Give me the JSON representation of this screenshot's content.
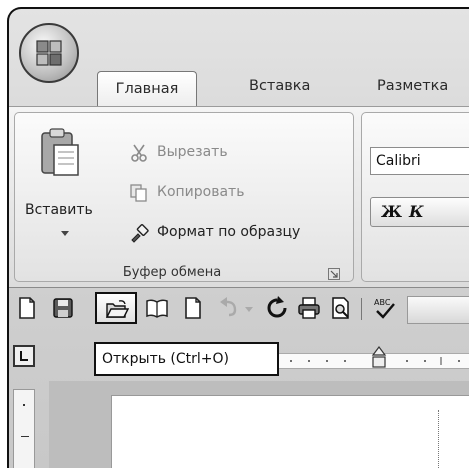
{
  "ribbon": {
    "tabs": [
      {
        "label": "Главная",
        "active": true
      },
      {
        "label": "Вставка",
        "active": false
      },
      {
        "label": "Разметка",
        "active": false
      }
    ],
    "clipboard": {
      "paste_label": "Вставить",
      "cut_label": "Вырезать",
      "copy_label": "Копировать",
      "format_painter_label": "Формат по образцу",
      "group_name": "Буфер обмена"
    },
    "font": {
      "font_name": "Calibri",
      "bold_label": "Ж",
      "italic_label": "К"
    }
  },
  "quick_access": {
    "icons": [
      "new-document-icon",
      "save-icon",
      "open-folder-icon",
      "open-book-icon",
      "blank-page-icon",
      "undo-icon",
      "dropdown-arrow-icon",
      "redo-icon",
      "print-icon",
      "print-preview-icon",
      "spelling-check-icon"
    ]
  },
  "tooltip": {
    "text": "Открыть (Ctrl+O)"
  }
}
